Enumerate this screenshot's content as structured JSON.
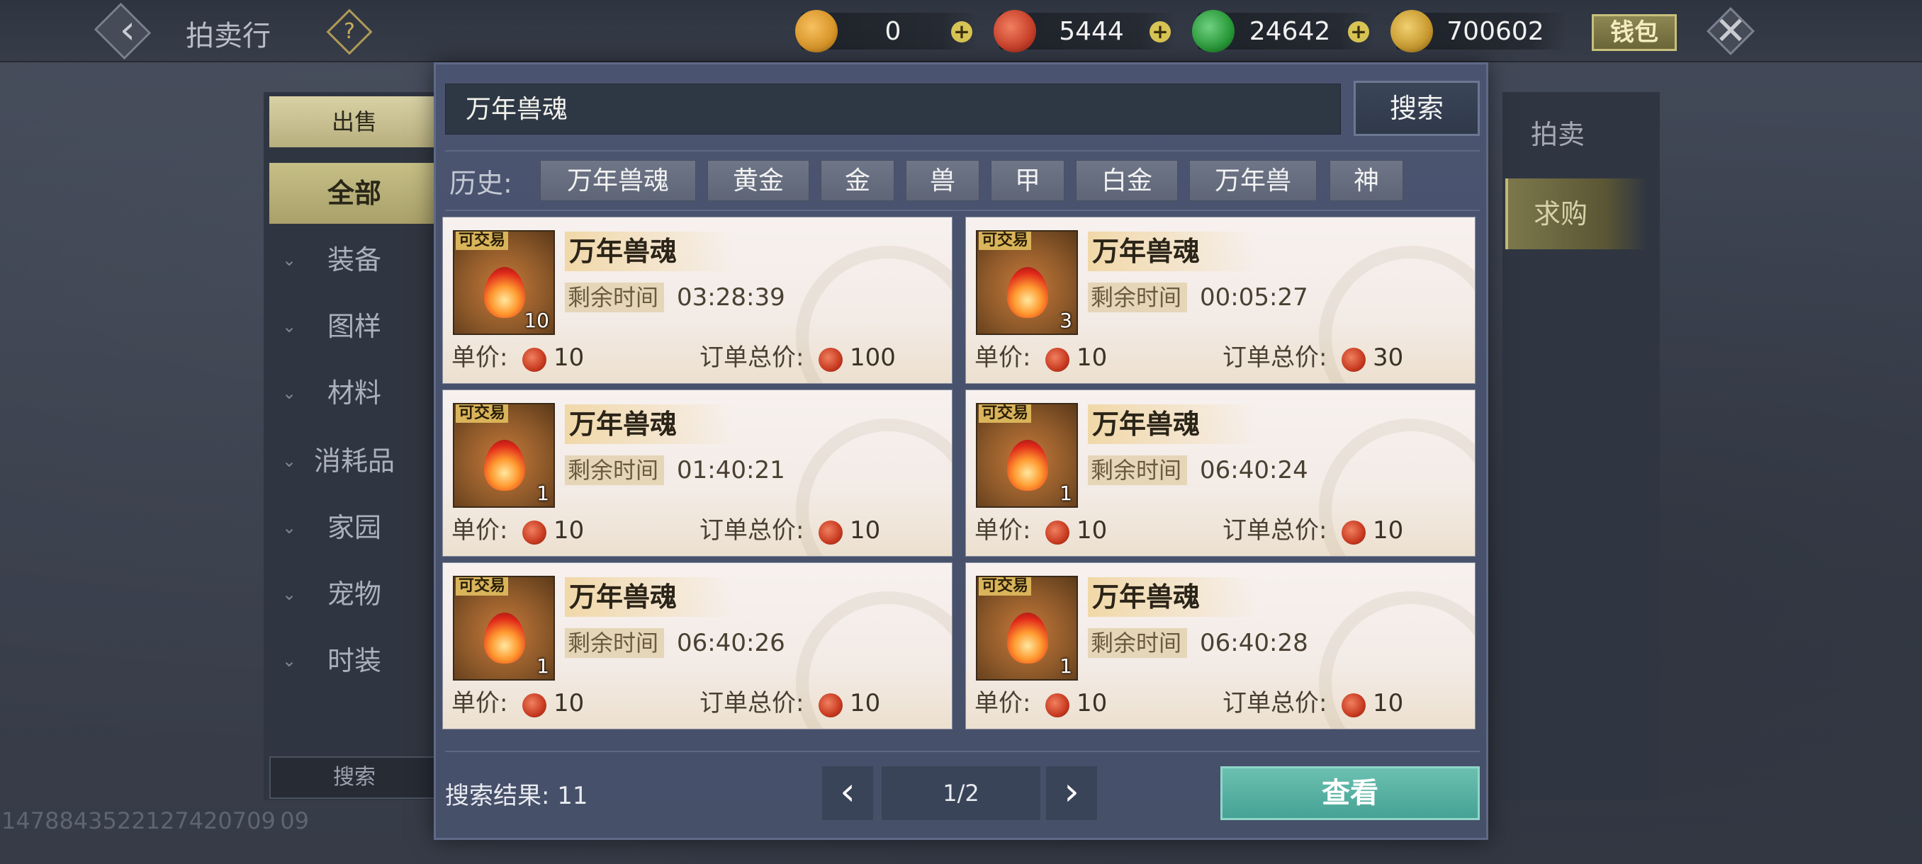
{
  "header": {
    "title": "拍卖行",
    "back_icon": "back-arrow-icon",
    "help_icon": "question-icon",
    "currencies": [
      {
        "icon": "gold-ingot-icon",
        "value": "0",
        "color": "#d9962a"
      },
      {
        "icon": "red-coin-icon",
        "value": "5444",
        "color": "#c8402a"
      },
      {
        "icon": "jade-coin-icon",
        "value": "24642",
        "color": "#2a9a3a"
      },
      {
        "icon": "gold-leaf-icon",
        "value": "700602",
        "color": "#c89a30"
      }
    ],
    "wallet_label": "钱包",
    "close_icon": "close-icon"
  },
  "left_nav": {
    "sell_label": "出售",
    "categories": [
      "全部",
      "装备",
      "图样",
      "材料",
      "消耗品",
      "家园",
      "宠物",
      "时装"
    ],
    "selected_category": "全部",
    "search_label": "搜索"
  },
  "right_tabs": {
    "items": [
      "拍卖",
      "求购"
    ],
    "active": "求购"
  },
  "user_id_text": "1478843522127420709 09",
  "search": {
    "value": "万年兽魂",
    "button_label": "搜索"
  },
  "history": {
    "label": "历史:",
    "chips": [
      "万年兽魂",
      "黄金",
      "金",
      "兽",
      "甲",
      "白金",
      "万年兽",
      "神"
    ]
  },
  "items": [
    {
      "tag": "可交易",
      "name": "万年兽魂",
      "qty": "10",
      "time_label": "剩余时间",
      "time": "03:28:39",
      "unit_label": "单价:",
      "unit_price": "10",
      "total_label": "订单总价:",
      "total_price": "100"
    },
    {
      "tag": "可交易",
      "name": "万年兽魂",
      "qty": "3",
      "time_label": "剩余时间",
      "time": "00:05:27",
      "unit_label": "单价:",
      "unit_price": "10",
      "total_label": "订单总价:",
      "total_price": "30"
    },
    {
      "tag": "可交易",
      "name": "万年兽魂",
      "qty": "1",
      "time_label": "剩余时间",
      "time": "01:40:21",
      "unit_label": "单价:",
      "unit_price": "10",
      "total_label": "订单总价:",
      "total_price": "10"
    },
    {
      "tag": "可交易",
      "name": "万年兽魂",
      "qty": "1",
      "time_label": "剩余时间",
      "time": "06:40:24",
      "unit_label": "单价:",
      "unit_price": "10",
      "total_label": "订单总价:",
      "total_price": "10"
    },
    {
      "tag": "可交易",
      "name": "万年兽魂",
      "qty": "1",
      "time_label": "剩余时间",
      "time": "06:40:26",
      "unit_label": "单价:",
      "unit_price": "10",
      "total_label": "订单总价:",
      "total_price": "10"
    },
    {
      "tag": "可交易",
      "name": "万年兽魂",
      "qty": "1",
      "time_label": "剩余时间",
      "time": "06:40:28",
      "unit_label": "单价:",
      "unit_price": "10",
      "total_label": "订单总价:",
      "total_price": "10"
    }
  ],
  "footer": {
    "result_label": "搜索结果:",
    "result_count": "11",
    "page": "1/2",
    "prev_icon": "chevron-left-icon",
    "next_icon": "chevron-right-icon",
    "view_label": "查看"
  }
}
